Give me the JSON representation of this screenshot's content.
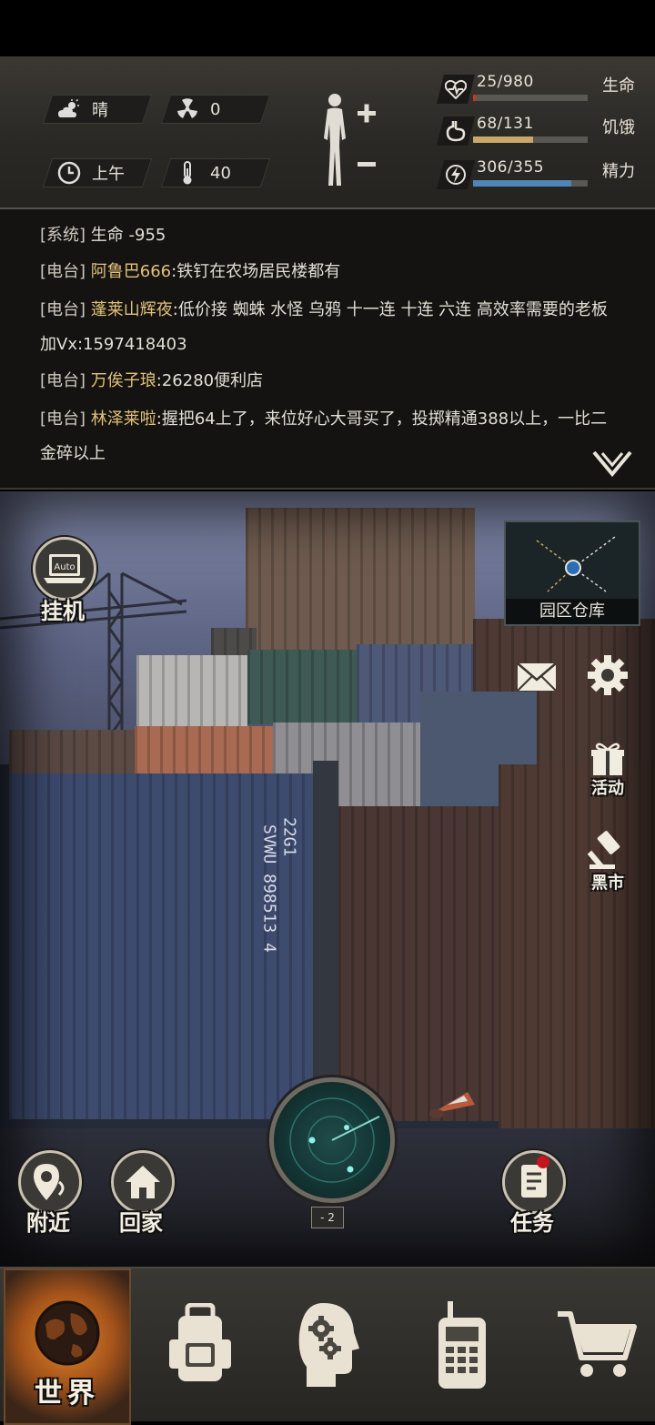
{
  "status": {
    "weather": {
      "label": "晴",
      "icon": "sun-cloud-icon"
    },
    "radiation": {
      "value": "0",
      "icon": "radiation-icon"
    },
    "time": {
      "label": "上午",
      "icon": "clock-icon"
    },
    "temperature": {
      "value": "40",
      "icon": "thermometer-icon"
    },
    "stats": [
      {
        "value": "25/980",
        "label": "生命",
        "fraction": 0.026,
        "color": "#c0392b",
        "icon": "heart-icon"
      },
      {
        "value": "68/131",
        "label": "饥饿",
        "fraction": 0.52,
        "color": "#c9a86a",
        "icon": "stomach-icon"
      },
      {
        "value": "306/355",
        "label": "精力",
        "fraction": 0.86,
        "color": "#4f84b8",
        "icon": "energy-icon"
      }
    ]
  },
  "chat": {
    "lines": [
      {
        "tag": "[系统]",
        "name": "",
        "text": "生命 -955"
      },
      {
        "tag": "[电台]",
        "name": "阿鲁巴666",
        "text": ":铁钉在农场居民楼都有"
      },
      {
        "tag": "[电台]",
        "name": "蓬莱山辉夜",
        "text": ":低价接 蜘蛛 水怪 乌鸦 十一连 十连 六连 高效率需要的老板加Vx:1597418403"
      },
      {
        "tag": "[电台]",
        "name": "万俟子琅",
        "text": ":26280便利店"
      },
      {
        "tag": "[电台]",
        "name": "林泽莱啦",
        "text": ":握把64上了，来位好心大哥买了，投掷精通388以上，一比二金碎以上"
      }
    ]
  },
  "scene": {
    "auto_button": {
      "label": "挂机",
      "badge": "Auto"
    },
    "map_card": {
      "label": "园区仓库"
    },
    "side": {
      "gift_label": "活动",
      "market_label": "黑市"
    },
    "container_text": "SVWU 898513 4",
    "container_text2": "22G1",
    "radar_badge": "- 2",
    "nearby_label": "附近",
    "home_label": "回家",
    "task_label": "任务"
  },
  "nav": {
    "world_label": "世界"
  }
}
